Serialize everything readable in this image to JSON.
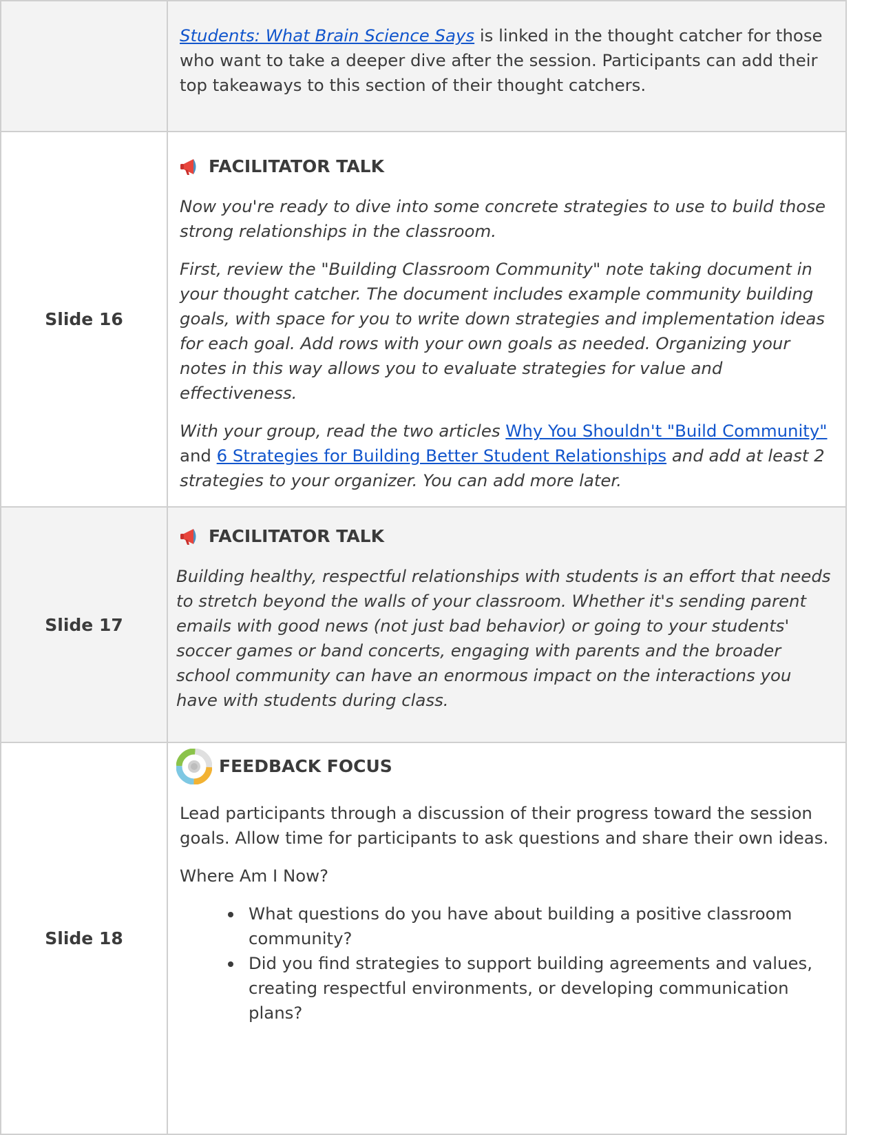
{
  "row0": {
    "link_text": "Students: What Brain Science Says",
    "text": " is linked in the thought catcher for those who want to take a deeper dive after the session. Participants can add their top takeaways to this section of their thought catchers."
  },
  "row16": {
    "slide_label": "Slide 16",
    "heading": "FACILITATOR TALK",
    "icon": "megaphone-icon",
    "p1": "Now you're ready to dive into some concrete strategies to use to build those strong relationships in the classroom.",
    "p2": "First, review the \"Building Classroom Community\" note taking document in your thought catcher. The document includes example community building goals, with space for you to write down strategies and implementation ideas for each goal. Add rows with your own goals as needed. Organizing your notes in this way allows you to evaluate strategies for value and effectiveness.",
    "p3_intro": "With your group, read the two articles ",
    "p3_link1": "Why You Shouldn't \"Build Community\"",
    "p3_and": " and ",
    "p3_link2": "6 Strategies for Building Better Student Relationships",
    "p3_outro": " and add at least 2 strategies to your organizer. You can add more later."
  },
  "row17": {
    "slide_label": "Slide 17",
    "heading": "FACILITATOR TALK",
    "icon": "megaphone-icon",
    "p1": "Building healthy, respectful relationships with students is an effort that needs to stretch beyond the walls of your classroom. Whether it's sending parent emails with good news (not just bad behavior) or going to your students' soccer games or band concerts, engaging with parents and the broader school community can have an enormous impact on the interactions you have with students during class."
  },
  "row18": {
    "slide_label": "Slide 18",
    "heading": "FEEDBACK FOCUS",
    "icon": "feedback-cycle-icon",
    "p1": "Lead participants through a discussion of their progress toward the session goals. Allow time for participants to ask questions and share their own ideas.",
    "p2": "Where Am I Now?",
    "bullets": [
      "What questions do you have about building a positive classroom community?",
      "Did you find strategies to support building agreements and values, creating respectful environments, or developing communication plans?"
    ]
  },
  "colors": {
    "link": "#1155cc",
    "text": "#3b3b3b",
    "shade": "#f3f3f3",
    "border": "#cfcfcf",
    "megaphone": "#e8453c"
  }
}
